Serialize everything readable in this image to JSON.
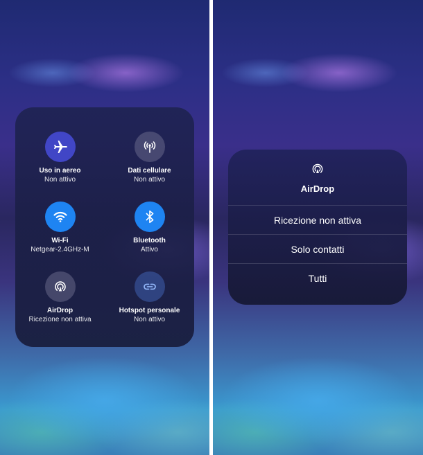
{
  "left_panel": {
    "tiles": [
      {
        "label": "Uso in aereo",
        "status": "Non attivo",
        "icon": "airplane-icon",
        "color": "#4146c6"
      },
      {
        "label": "Dati cellulare",
        "status": "Non attivo",
        "icon": "cellular-antenna-icon",
        "color": "dim"
      },
      {
        "label": "Wi-Fi",
        "status": "Netgear-2.4GHz-M",
        "icon": "wifi-icon",
        "color": "#1e84f2"
      },
      {
        "label": "Bluetooth",
        "status": "Attivo",
        "icon": "bluetooth-icon",
        "color": "#1e84f2"
      },
      {
        "label": "AirDrop",
        "status": "Ricezione non attiva",
        "icon": "airdrop-icon",
        "color": "dim"
      },
      {
        "label": "Hotspot personale",
        "status": "Non attivo",
        "icon": "hotspot-link-icon",
        "color": "dim-blue"
      }
    ]
  },
  "airdrop_menu": {
    "title": "AirDrop",
    "icon": "airdrop-icon",
    "options": [
      "Ricezione non attiva",
      "Solo contatti",
      "Tutti"
    ]
  },
  "colors": {
    "active_blue": "#1e84f2",
    "airplane_indigo": "#4146c6"
  }
}
